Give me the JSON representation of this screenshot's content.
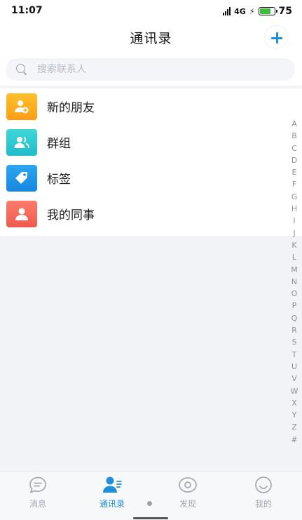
{
  "status_bar": {
    "time": "11:07",
    "signal_text": "4G",
    "battery_percent": "75"
  },
  "header": {
    "title": "通讯录"
  },
  "search": {
    "placeholder": "搜索联系人"
  },
  "entries": [
    {
      "label": "新的朋友",
      "icon": "user-plus-icon",
      "color": "#ffb020"
    },
    {
      "label": "群组",
      "icon": "group-icon",
      "color": "#2cc9d3"
    },
    {
      "label": "标签",
      "icon": "tag-icon",
      "color": "#1f97ea"
    },
    {
      "label": "我的同事",
      "icon": "colleague-icon",
      "color": "#f5665a"
    }
  ],
  "index_letters": [
    "A",
    "B",
    "C",
    "D",
    "E",
    "F",
    "G",
    "H",
    "I",
    "J",
    "K",
    "L",
    "M",
    "N",
    "O",
    "P",
    "Q",
    "R",
    "S",
    "T",
    "U",
    "V",
    "W",
    "X",
    "Y",
    "Z",
    "#"
  ],
  "tabs": [
    {
      "label": "消息",
      "icon": "message-icon",
      "active": false
    },
    {
      "label": "通讯录",
      "icon": "contacts-icon",
      "active": true
    },
    {
      "label": "发现",
      "icon": "discover-icon",
      "active": false
    },
    {
      "label": "我的",
      "icon": "profile-icon",
      "active": false
    }
  ],
  "colors": {
    "accent": "#1f8fdc",
    "inactive": "#a3a9b1"
  }
}
